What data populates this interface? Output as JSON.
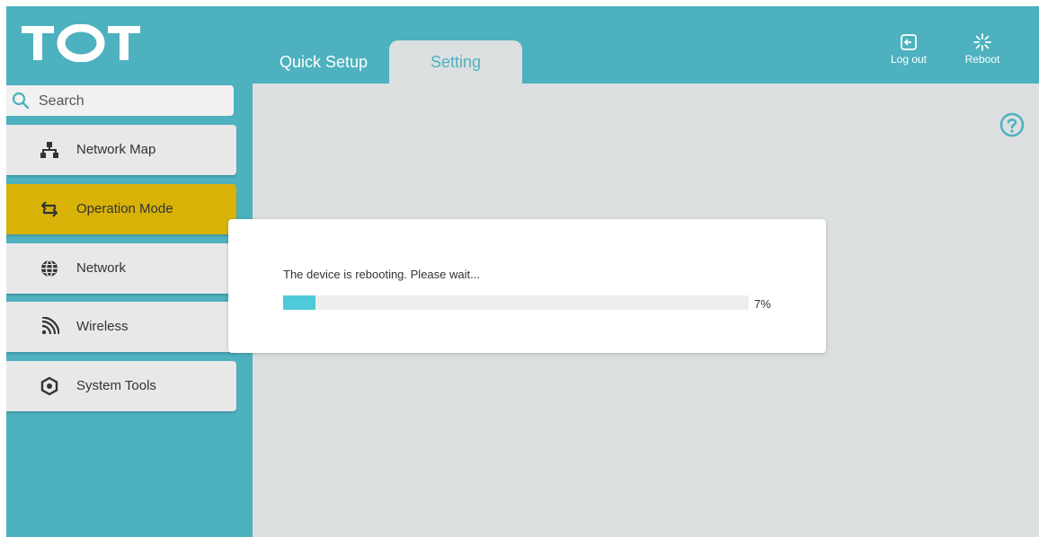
{
  "brand": {
    "logo_text": "TOT"
  },
  "tabs": [
    {
      "label": "Quick Setup",
      "active": false
    },
    {
      "label": "Setting",
      "active": true
    }
  ],
  "header_actions": {
    "logout_label": "Log out",
    "reboot_label": "Reboot"
  },
  "search": {
    "placeholder": "Search"
  },
  "sidebar": {
    "items": [
      {
        "label": "Network Map",
        "icon": "network-map-icon",
        "active": false
      },
      {
        "label": "Operation Mode",
        "icon": "operation-mode-icon",
        "active": true
      },
      {
        "label": "Network",
        "icon": "globe-icon",
        "active": false
      },
      {
        "label": "Wireless",
        "icon": "wireless-icon",
        "active": false
      },
      {
        "label": "System Tools",
        "icon": "system-tools-icon",
        "active": false
      }
    ]
  },
  "modal": {
    "message": "The device is rebooting. Please wait...",
    "progress_percent": 7,
    "progress_label": "7%"
  },
  "colors": {
    "brand_teal": "#4db1bf",
    "active_item": "#d9b208",
    "progress_fill": "#4ec9d8",
    "content_bg": "#dcdfe0"
  }
}
